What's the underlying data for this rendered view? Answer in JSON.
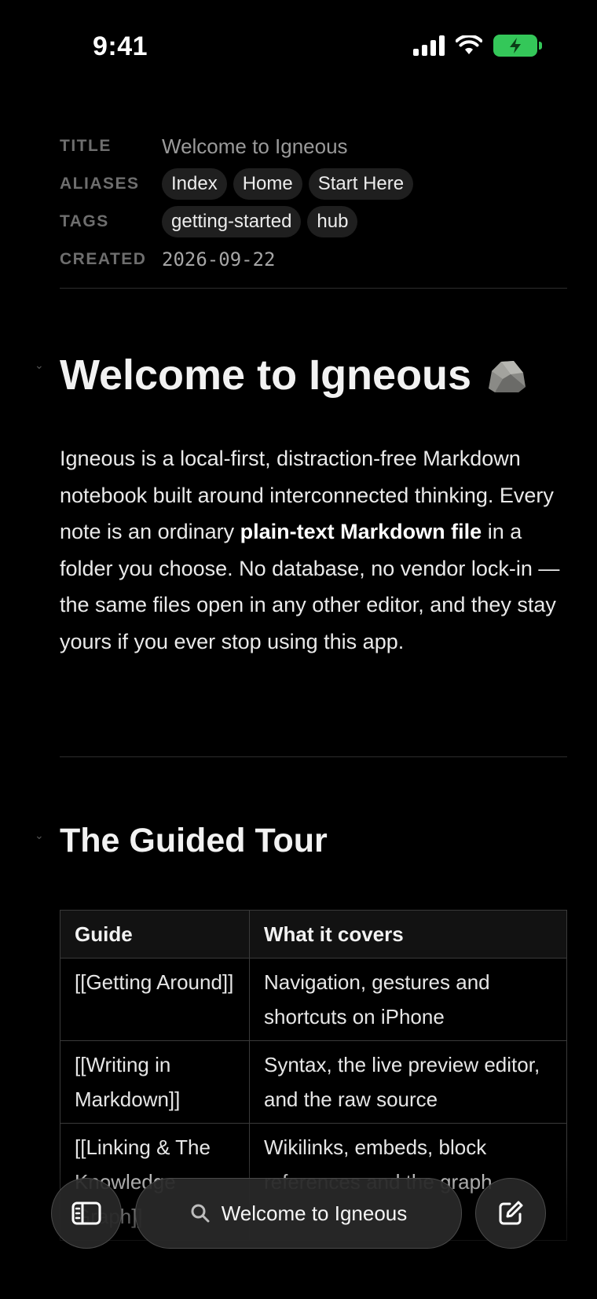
{
  "status_bar": {
    "time": "9:41"
  },
  "properties": {
    "title_label": "TITLE",
    "title_value": "Welcome to Igneous",
    "aliases_label": "ALIASES",
    "aliases": [
      "Index",
      "Home",
      "Start Here"
    ],
    "tags_label": "TAGS",
    "tags": [
      "getting-started",
      "hub"
    ],
    "created_label": "CREATED",
    "created_value": "2026-09-22"
  },
  "doc": {
    "heading": "Welcome to Igneous",
    "intro_part1": "Igneous is a local-first, distraction-free Markdown notebook built around interconnected thinking. Every note is an ordinary ",
    "intro_bold": "plain-text Markdown file",
    "intro_part2": " in a folder you choose. No database, no vendor lock-in — the same files open in any other editor, and they stay yours if you ever stop using this app.",
    "section_heading": "The Guided Tour",
    "table": {
      "headers": [
        "Guide",
        "What it covers"
      ],
      "rows": [
        [
          "[[Getting Around]]",
          "Navigation, gestures and shortcuts on iPhone"
        ],
        [
          "[[Writing in Markdown]]",
          "Syntax, the live preview editor, and the raw source"
        ],
        [
          "[[Linking & The Knowledge Graph]]",
          "Wikilinks, embeds, block references and the graph"
        ]
      ]
    }
  },
  "bottom_bar": {
    "search_label": "Welcome to Igneous"
  },
  "colors": {
    "background": "#000000",
    "battery": "#34c759",
    "chip": "#1f1f1f"
  }
}
